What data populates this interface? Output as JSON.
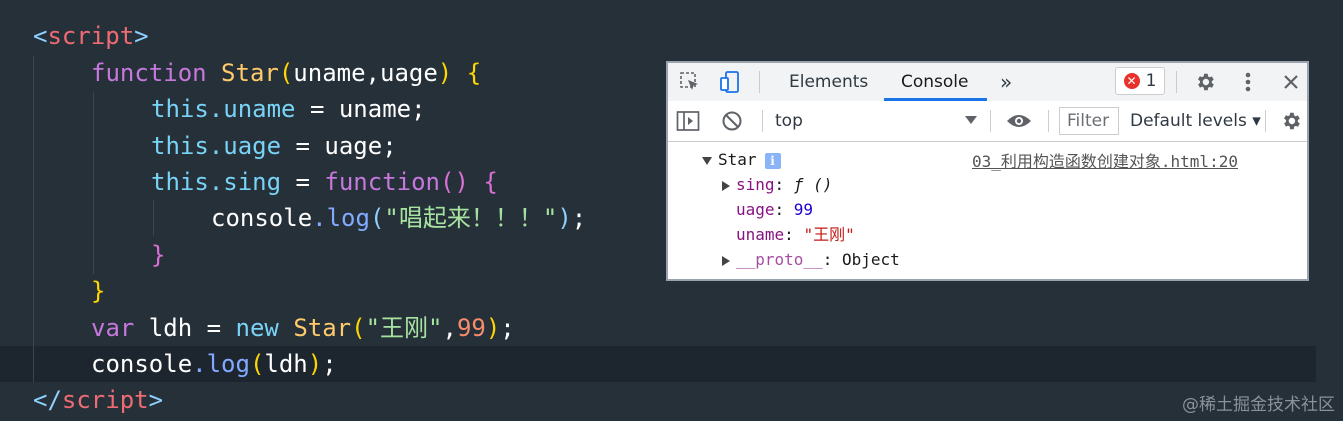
{
  "editor": {
    "line1": {
      "open": "<",
      "tag": "script",
      "close": ">"
    },
    "line2": {
      "kw": "function",
      "name": "Star",
      "open": "(",
      "params": "uname,uage",
      "close": ")",
      "brace": "{"
    },
    "line3": {
      "this": "this",
      "prop": ".uname",
      "rest": " = uname;"
    },
    "line4": {
      "this": "this",
      "prop": ".uage",
      "rest": " = uage;"
    },
    "line5": {
      "this": "this",
      "prop": ".sing",
      "eq": " = ",
      "kw": "function",
      "parens": "()",
      "brace": "{"
    },
    "line6": {
      "obj": "console",
      "method": ".log",
      "open": "(",
      "str": "\"唱起来！！！\"",
      "close": ")",
      "semi": ";"
    },
    "line7": {
      "brace": "}"
    },
    "line8": {
      "brace": "}"
    },
    "line9": {
      "kw": "var",
      "ident": " ldh = ",
      "kw2": "new",
      "cls": " Star",
      "open": "(",
      "str": "\"王刚\"",
      "comma": ",",
      "num": "99",
      "close": ")",
      "semi": ";"
    },
    "line10": {
      "obj": "console",
      "method": ".log",
      "open": "(",
      "arg": "ldh",
      "close": ")",
      "semi": ";"
    },
    "line11": {
      "open": "</",
      "tag": "script",
      "close": ">"
    }
  },
  "devtools": {
    "tabs": [
      "Elements",
      "Console"
    ],
    "more_tabs": "»",
    "error_count": "1",
    "context": "top",
    "filter_placeholder": "Filter",
    "levels": "Default levels ▾",
    "console": {
      "object_name": "Star",
      "source": "03_利用构造函数创建对象.html:20",
      "props": {
        "sing_key": "sing",
        "sing_val": "ƒ ()",
        "uage_key": "uage",
        "uage_val": "99",
        "uname_key": "uname",
        "uname_val": "\"王刚\"",
        "proto_key": "__proto__",
        "proto_val": "Object"
      }
    }
  },
  "watermark": "@稀土掘金技术社区",
  "colors": {
    "background": "#263039",
    "accent": "#1a73e8",
    "error": "#e8322c"
  }
}
